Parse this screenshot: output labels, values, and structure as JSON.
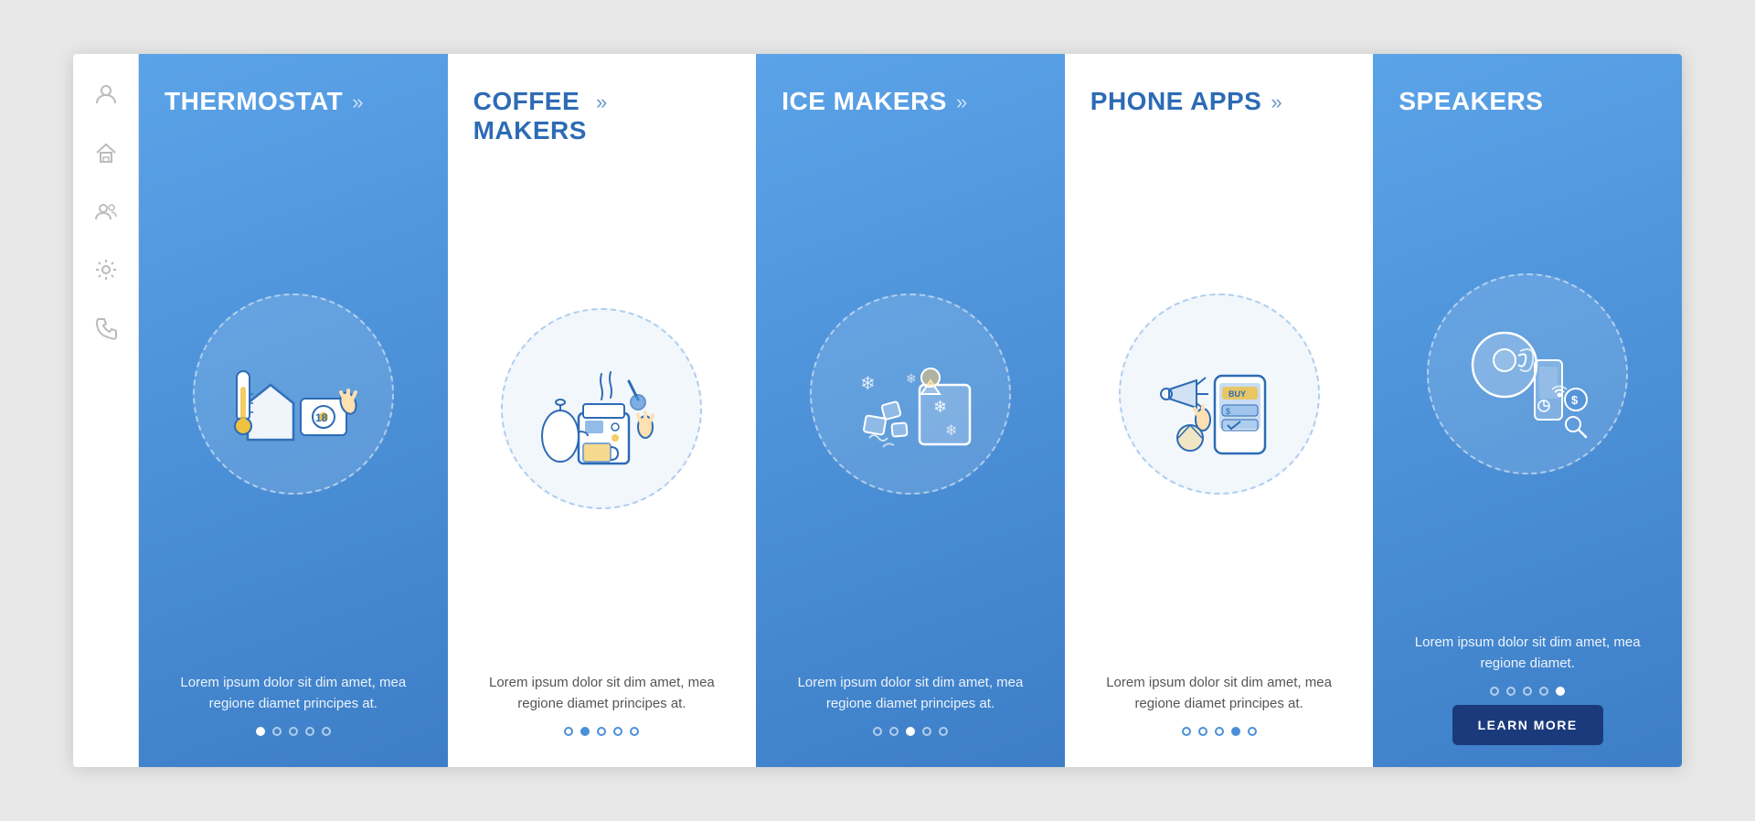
{
  "sidebar": {
    "icons": [
      {
        "name": "user-icon",
        "symbol": "👤"
      },
      {
        "name": "home-icon",
        "symbol": "🏠"
      },
      {
        "name": "contacts-icon",
        "symbol": "👥"
      },
      {
        "name": "settings-icon",
        "symbol": "⚙"
      },
      {
        "name": "phone-icon",
        "symbol": "📞"
      }
    ]
  },
  "cards": [
    {
      "id": "thermostat",
      "title": "THERMOSTAT",
      "background": "blue",
      "description": "Lorem ipsum dolor sit dim amet, mea regione diamet principes at.",
      "dots": [
        true,
        false,
        false,
        false,
        false
      ],
      "showLearnMore": false
    },
    {
      "id": "coffee-makers",
      "title": "COFFEE\nMAKERS",
      "background": "white",
      "description": "Lorem ipsum dolor sit dim amet, mea regione diamet principes at.",
      "dots": [
        false,
        true,
        false,
        false,
        false
      ],
      "showLearnMore": false
    },
    {
      "id": "ice-makers",
      "title": "ICE MAKERS",
      "background": "blue",
      "description": "Lorem ipsum dolor sit dim amet, mea regione diamet principes at.",
      "dots": [
        false,
        false,
        true,
        false,
        false
      ],
      "showLearnMore": false
    },
    {
      "id": "phone-apps",
      "title": "PHONE APPS",
      "background": "white",
      "description": "Lorem ipsum dolor sit dim amet, mea regione diamet principes at.",
      "dots": [
        false,
        false,
        false,
        true,
        false
      ],
      "showLearnMore": false
    },
    {
      "id": "speakers",
      "title": "SPEAKERS",
      "background": "blue",
      "description": "Lorem ipsum dolor sit dim amet, mea regione diamet.",
      "dots": [
        false,
        false,
        false,
        false,
        true
      ],
      "showLearnMore": true,
      "learnMoreLabel": "LEARN MORE"
    }
  ],
  "colors": {
    "blue": "#4a8fd4",
    "dark_blue": "#1e3f7a",
    "text_blue": "#2d6bb5",
    "yellow": "#f0c040",
    "white": "#ffffff",
    "text_gray": "#555555"
  }
}
